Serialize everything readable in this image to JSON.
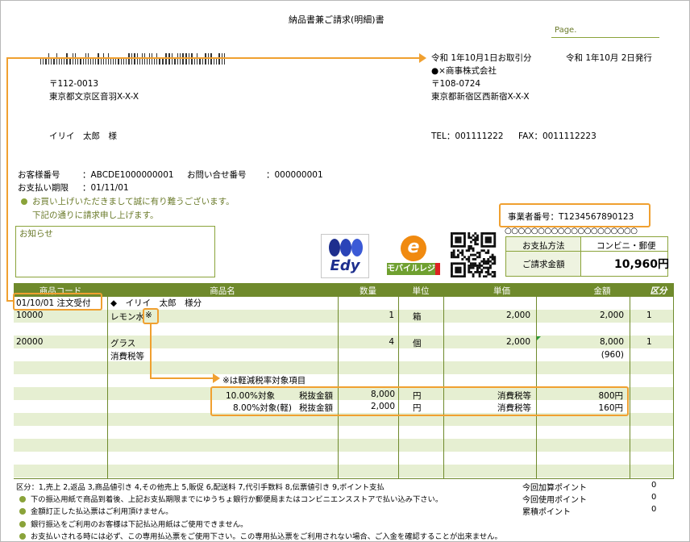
{
  "title": "納品書兼ご請求(明細)書",
  "page_label": "Page.",
  "barcode_alt": "barcode",
  "transaction_date": "令和 1年10月1日お取引分",
  "issue_date": "令和 1年10月 2日発行",
  "sender": {
    "company": "●×商事株式会社",
    "postal": "〒108-0724",
    "address": "東京都新宿区西新宿X-X-X",
    "tel": "TEL：001111222",
    "fax": "FAX：0011112223"
  },
  "recipient": {
    "postal": "〒112-0013",
    "address": "東京都文京区音羽X-X-X",
    "name": "イリイ　太郎　様"
  },
  "customer": {
    "number_label": "お客様番号",
    "number_value": "：ABCDE1000000001",
    "inquiry_label": "お問い合せ番号",
    "inquiry_value": "：000000001",
    "due_label": "お支払い期限",
    "due_value": "：01/11/01"
  },
  "greeting": {
    "line1": "お買い上げいただきまして誠に有り難うございます。",
    "line2": "下記の通りに請求申し上げます。"
  },
  "notice_label": "お知らせ",
  "registration": "事業者番号：T1234567890123",
  "circles": "○○○○○○○○○○○○○○○○○○○○",
  "logos": {
    "edy": "Edy",
    "mobile": "モバイルレジ"
  },
  "payment": {
    "method_label": "お支払方法",
    "method_value": "コンビニ・郵便",
    "amount_label": "ご請求金額",
    "amount_value": "10,960円"
  },
  "table": {
    "headers": [
      "商品コード",
      "商品名",
      "数量",
      "単位",
      "単価",
      "金額",
      "区分"
    ],
    "order_date": "01/10/01 注文受付",
    "order_name": "◆　イリイ　太郎　様分",
    "rows": [
      {
        "code": "10000",
        "name": "レモン水",
        "mark": "※",
        "qty": "1",
        "unit": "箱",
        "price": "2,000",
        "amount": "2,000",
        "kbn": "1"
      },
      {
        "code": "20000",
        "name": "グラス",
        "mark": "",
        "qty": "4",
        "unit": "個",
        "price": "2,000",
        "amount": "8,000",
        "kbn": "1"
      }
    ],
    "tax_label": "消費税等",
    "tax_amount": "(960)",
    "reduced_note": "※は軽減税率対象項目",
    "summary": [
      {
        "rate": "10.00%対象",
        "base_label": "税抜金額",
        "base": "8,000",
        "yen": "円",
        "tax_label": "消費税等",
        "tax": "800円"
      },
      {
        "rate": "8.00%対象(軽)",
        "base_label": "税抜金額",
        "base": "2,000",
        "yen": "円",
        "tax_label": "消費税等",
        "tax": "160円"
      }
    ]
  },
  "footer": {
    "category": "区分：1,売上 2,返品 3,商品値引き 4,その他売上 5,販促 6,配送料 7,代引手数料 8,伝票値引き 9,ポイント支払",
    "notes": [
      "下の振込用紙で商品到着後、上記お支払期限までにゆうちょ銀行か郵便局またはコンビニエンスストアで払い込み下さい。",
      "金額訂正した払込票はご利用頂けません。",
      "銀行振込をご利用のお客様は下記払込用紙はご使用できません。",
      "お支払いされる時には必ず、この専用払込票をご使用下さい。この専用払込票をご利用されない場合、ご入金を確認することが出来ません。"
    ],
    "points": [
      {
        "label": "今回加算ポイント",
        "value": "0"
      },
      {
        "label": "今回使用ポイント",
        "value": "0"
      },
      {
        "label": "累積ポイント",
        "value": "0"
      }
    ]
  }
}
